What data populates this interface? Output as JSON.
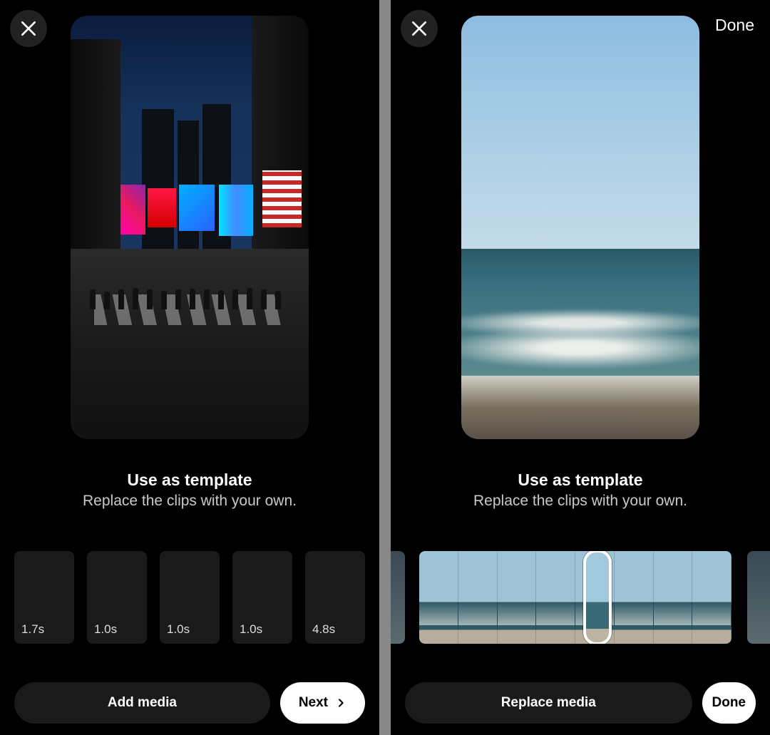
{
  "left": {
    "title": "Use as template",
    "subtitle": "Replace the clips with your own.",
    "clips": [
      {
        "duration": "1.7s"
      },
      {
        "duration": "1.0s"
      },
      {
        "duration": "1.0s"
      },
      {
        "duration": "1.0s"
      },
      {
        "duration": "4.8s"
      }
    ],
    "primary_button": "Add media",
    "secondary_button": "Next"
  },
  "right": {
    "done_top": "Done",
    "title": "Use as template",
    "subtitle": "Replace the clips with your own.",
    "primary_button": "Replace media",
    "secondary_button": "Done"
  }
}
